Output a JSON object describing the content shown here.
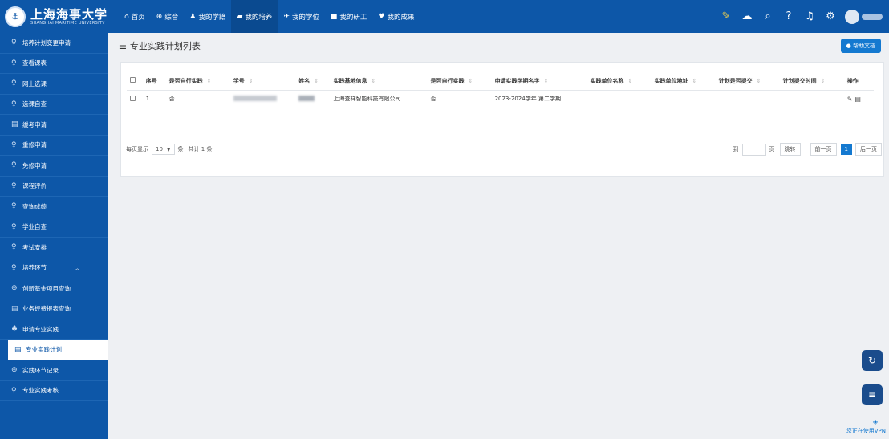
{
  "header": {
    "logo_cn": "上海海事大学",
    "logo_en": "SHANGHAI MARITIME UNIVERSITY",
    "nav": [
      {
        "icon": "home-icon",
        "glyph": "⌂",
        "label": "首页"
      },
      {
        "icon": "overview-icon",
        "glyph": "⊕",
        "label": "综合"
      },
      {
        "icon": "user-icon",
        "glyph": "♟",
        "label": "我的学籍"
      },
      {
        "icon": "book-icon",
        "glyph": "▰",
        "label": "我的培养"
      },
      {
        "icon": "graduation-cap-icon",
        "glyph": "✈",
        "label": "我的学位"
      },
      {
        "icon": "card-icon",
        "glyph": "■",
        "label": "我的研工"
      },
      {
        "icon": "trophy-icon",
        "glyph": "♥",
        "label": "我的成果"
      }
    ],
    "active_nav": 3
  },
  "sidebar": {
    "items": [
      {
        "icon": "user-outline-icon",
        "glyph": "♀",
        "label": "培养计划变更申请"
      },
      {
        "icon": "user-outline-icon",
        "glyph": "♀",
        "label": "查看课表"
      },
      {
        "icon": "user-outline-icon",
        "glyph": "♀",
        "label": "网上选课"
      },
      {
        "icon": "user-outline-icon",
        "glyph": "♀",
        "label": "选课自查"
      },
      {
        "icon": "form-icon",
        "glyph": "▤",
        "label": "缓考申请"
      },
      {
        "icon": "user-outline-icon",
        "glyph": "♀",
        "label": "重修申请"
      },
      {
        "icon": "user-outline-icon",
        "glyph": "♀",
        "label": "免修申请"
      },
      {
        "icon": "user-outline-icon",
        "glyph": "♀",
        "label": "课程评价"
      },
      {
        "icon": "user-outline-icon",
        "glyph": "♀",
        "label": "查询成绩"
      },
      {
        "icon": "user-outline-icon",
        "glyph": "♀",
        "label": "学业自查"
      },
      {
        "icon": "user-outline-icon",
        "glyph": "♀",
        "label": "考试安排"
      },
      {
        "icon": "user-outline-icon",
        "glyph": "♀",
        "label": "培养环节",
        "expanded": true
      },
      {
        "icon": "flow-icon",
        "glyph": "⊕",
        "label": "创新基金项目查询"
      },
      {
        "icon": "form-icon",
        "glyph": "▤",
        "label": "业务经费报表查询"
      },
      {
        "icon": "group-icon",
        "glyph": "♣",
        "label": "申请专业实践"
      },
      {
        "icon": "doc-icon",
        "glyph": "▤",
        "label": "专业实践计划",
        "active": true
      },
      {
        "icon": "flow-icon",
        "glyph": "⊕",
        "label": "实践环节记录"
      },
      {
        "icon": "user-outline-icon",
        "glyph": "♀",
        "label": "专业实践考核"
      }
    ]
  },
  "main": {
    "title": "专业实践计划列表",
    "help_label": "帮助文档",
    "table": {
      "columns": [
        "",
        "序号",
        "是否自行实践",
        "学号",
        "姓名",
        "实践基地信息",
        "是否自行实践",
        "申请实践学期名字",
        "实践单位名称",
        "实践单位地址",
        "计划是否提交",
        "计划提交时间",
        "操作"
      ],
      "rows": [
        {
          "index": "1",
          "self_practice": "否",
          "base_info": "上海查祥智能科技有限公司",
          "self_practice2": "否",
          "semester": "2023-2024学年 第二学期",
          "unit_name": "",
          "unit_addr": "",
          "submitted": "",
          "submit_time": ""
        }
      ]
    },
    "pager": {
      "per_page_label": "每页显示",
      "per_page": "10",
      "unit": "条",
      "total": "共计 1 条",
      "goto_label": "到",
      "page_label": "页",
      "jump_label": "跳转",
      "prev_label": "前一页",
      "current": "1",
      "next_label": "后一页"
    }
  },
  "vpn_text": "您正在使用VPN"
}
